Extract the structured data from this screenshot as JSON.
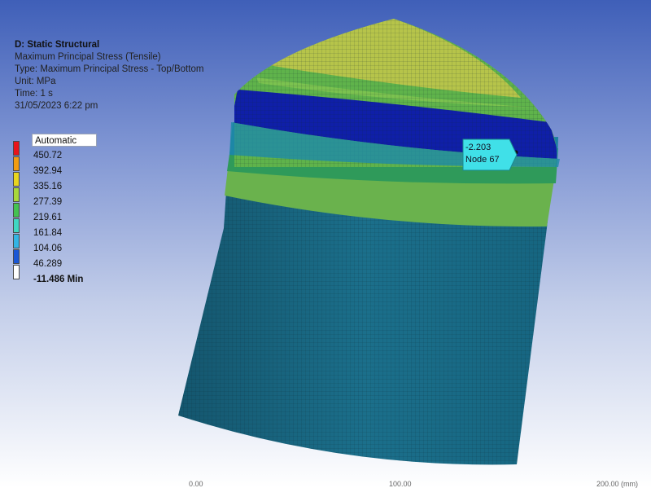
{
  "info": {
    "title": "D: Static Structural",
    "result": "Maximum Principal Stress (Tensile)",
    "type": "Type: Maximum Principal Stress - Top/Bottom",
    "unit": "Unit: MPa",
    "time": "Time: 1 s",
    "timestamp": "31/05/2023 6:22 pm"
  },
  "legend": {
    "mode": "Automatic",
    "labels": [
      "450.72",
      "392.94",
      "335.16",
      "277.39",
      "219.61",
      "161.84",
      "104.06",
      "46.289",
      "-11.486 Min"
    ],
    "colors": [
      "#e8131a",
      "#f39c12",
      "#e8d51f",
      "#a8d83b",
      "#44c251",
      "#3fd7c3",
      "#33b4e4",
      "#1a57d6",
      "#ffffff"
    ]
  },
  "probe": {
    "value": "-2.203",
    "node": "Node 67",
    "color": "#40e0e8"
  },
  "model": {
    "colors": {
      "dome_tip": "#b8c64a",
      "dome_green": "#5fb34b",
      "dark_blue_band": "#0f1fa8",
      "teal_band": "#1b7fa0",
      "light_green_band": "#67b64e",
      "body": "#1a6e8a"
    }
  },
  "axis": {
    "ticks": [
      "0.00",
      "100.00",
      "200.00 (mm)"
    ]
  }
}
